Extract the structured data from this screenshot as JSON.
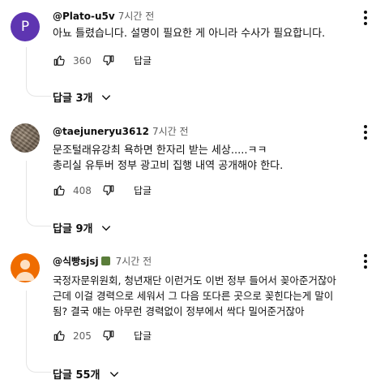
{
  "comments": [
    {
      "author": "@Plato-u5v",
      "time": "7시간 전",
      "avatar_letter": "P",
      "lines": [
        "아뇨 틀렸습니다. 설명이 필요한 게 아니라 수사가 필요합니다."
      ],
      "likes": "360",
      "reply_label": "답글",
      "replies_label": "답글 3개"
    },
    {
      "author": "@taejuneryu3612",
      "time": "7시간 전",
      "lines": [
        "문조털래유강최 욕하면 한자리 받는 세상.....ㅋㅋ",
        "총리실 유투버 정부 광고비 집행 내역 공개해야 한다."
      ],
      "likes": "408",
      "reply_label": "답글",
      "replies_label": "답글 9개"
    },
    {
      "author": "@식빵sjsj",
      "time": "7시간 전",
      "lines": [
        "국정자문위원회, 청년재단 이런거도 이번 정부 들어서 꽂아준거잖아",
        "근데 이걸 경력으로 세워서  그 다음 또다른 곳으로 꽂힌다는게 말이",
        "됨?  결국 얘는 아무런 경력없이 정부에서 싹다 밀어준거잖아"
      ],
      "likes": "205",
      "reply_label": "답글",
      "replies_label": "답글 55개"
    }
  ],
  "colors": {
    "avatar_p": "#5e35b1",
    "avatar_orange": "#ef6c00",
    "secondary_text": "#606060"
  },
  "icons": {
    "like": "thumb-up-icon",
    "dislike": "thumb-down-icon",
    "menu": "more-vert-icon",
    "expand": "chevron-down-icon"
  }
}
